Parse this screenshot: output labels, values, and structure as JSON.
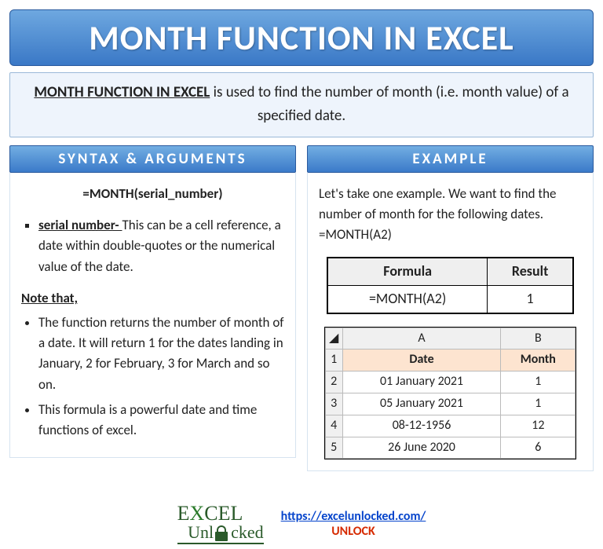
{
  "title": "MONTH FUNCTION IN EXCEL",
  "description": {
    "bold": "MONTH FUNCTION IN EXCEL",
    "rest": " is used to find the number of month (i.e. month value) of a specified date."
  },
  "syntax": {
    "header": "SYNTAX & ARGUMENTS",
    "formula": "=MONTH(serial_number)",
    "arg_label": "serial number- ",
    "arg_text": "This can be a cell reference, a date within double-quotes or the numerical value of the date.",
    "note_label": "Note that,",
    "notes": [
      "The function returns the number of month of a date. It will return 1 for the dates landing in January, 2 for February, 3 for March and so on.",
      "This formula is a powerful date and time functions of excel."
    ]
  },
  "example": {
    "header": "EXAMPLE",
    "intro": "Let's take one example. We want to find the number of month for the following dates.",
    "formula_line": "=MONTH(A2)",
    "table1": {
      "h1": "Formula",
      "h2": "Result",
      "c1": "=MONTH(A2)",
      "c2": "1"
    },
    "table2": {
      "cols": [
        "A",
        "B"
      ],
      "headers": [
        "Date",
        "Month"
      ],
      "rows": [
        {
          "n": "2",
          "a": "01 January 2021",
          "b": "1"
        },
        {
          "n": "3",
          "a": "05 January 2021",
          "b": "1"
        },
        {
          "n": "4",
          "a": "08-12-1956",
          "b": "12"
        },
        {
          "n": "5",
          "a": "26 June 2020",
          "b": "6"
        }
      ]
    }
  },
  "footer": {
    "logo_left": "E",
    "logo_mid_x": "X",
    "logo_mid": "CEL",
    "logo_bottom": "nl",
    "logo_bottom2": "cked",
    "url": "https://excelunlocked.com/",
    "unlock": "UNLOCK"
  },
  "chart_data": {
    "type": "table",
    "title": "MONTH function example results",
    "columns": [
      "Date",
      "Month"
    ],
    "rows": [
      [
        "01 January 2021",
        1
      ],
      [
        "05 January 2021",
        1
      ],
      [
        "08-12-1956",
        12
      ],
      [
        "26 June 2020",
        6
      ]
    ]
  }
}
